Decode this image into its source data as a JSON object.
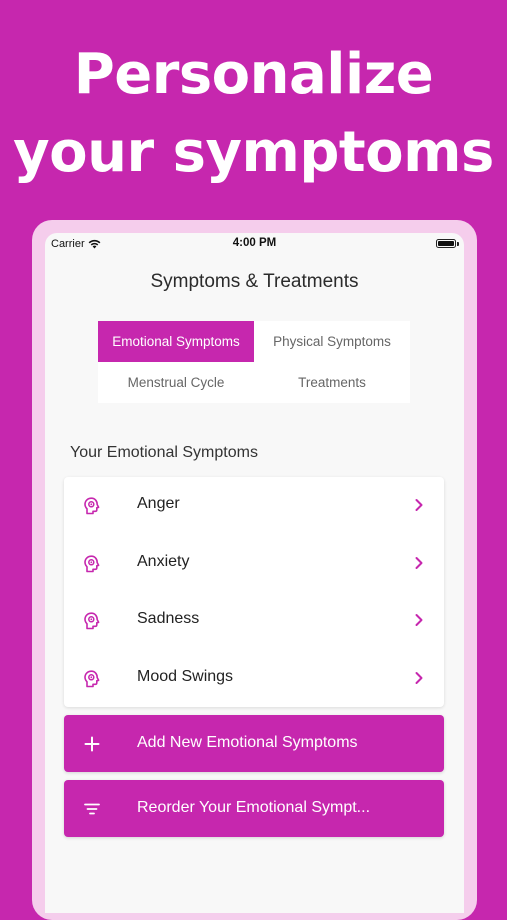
{
  "headline": {
    "line1": "Personalize",
    "line2": "your symptoms"
  },
  "status_bar": {
    "carrier": "Carrier",
    "time": "4:00 PM"
  },
  "nav": {
    "title": "Symptoms & Treatments"
  },
  "tabs": [
    {
      "label": "Emotional Symptoms",
      "active": true
    },
    {
      "label": "Physical Symptoms",
      "active": false
    },
    {
      "label": "Menstrual Cycle",
      "active": false
    },
    {
      "label": "Treatments",
      "active": false
    }
  ],
  "section": {
    "title": "Your Emotional Symptoms"
  },
  "symptoms": [
    {
      "label": "Anger",
      "icon": "head-brain-icon"
    },
    {
      "label": "Anxiety",
      "icon": "head-brain-icon"
    },
    {
      "label": "Sadness",
      "icon": "head-brain-icon"
    },
    {
      "label": "Mood Swings",
      "icon": "head-brain-icon"
    }
  ],
  "actions": {
    "add_label": "Add New Emotional Symptoms",
    "add_icon": "plus-icon",
    "reorder_label": "Reorder Your Emotional Sympt...",
    "reorder_icon": "sort-lines-icon"
  },
  "colors": {
    "accent": "#c627ae",
    "frame": "#f5cdec",
    "screen_bg": "#f8f8f8"
  }
}
